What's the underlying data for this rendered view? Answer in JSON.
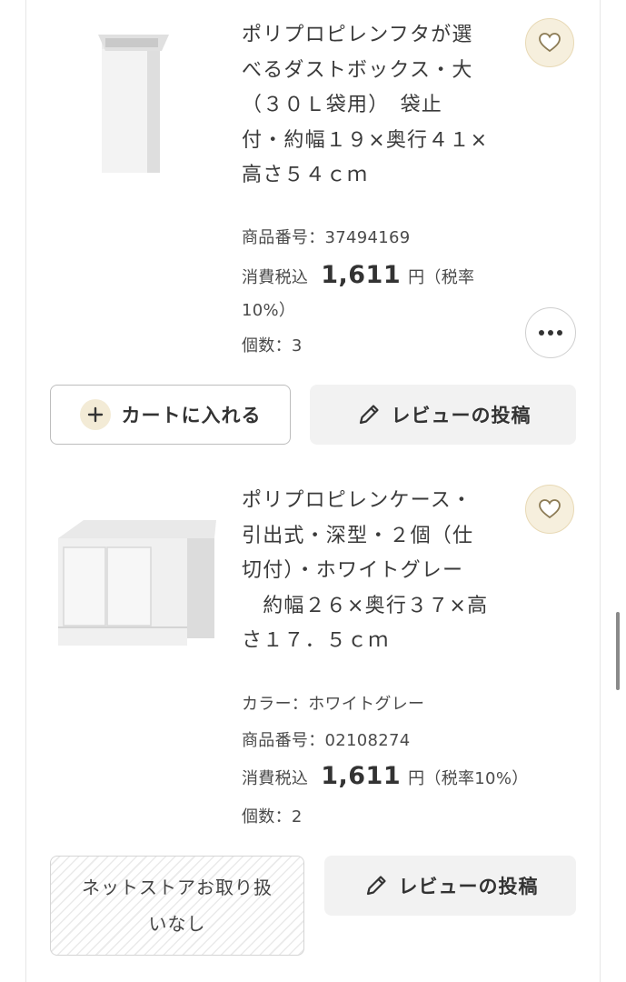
{
  "items": [
    {
      "title_lines": [
        "ポリプロピレンフタが選",
        "べるダストボックス・大",
        "（３０Ｌ袋用）　袋止",
        "付・約幅１９×奥行４１×",
        "高さ５４ｃｍ"
      ],
      "product_number": "商品番号：37494169",
      "price_label": "消費税込",
      "price": "1,611",
      "price_unit_line1": "円（税率",
      "price_unit_line2": "10%）",
      "quantity": "個数：3",
      "cart_button": "カートに入れる",
      "review_button": "レビューの投稿"
    },
    {
      "title_lines": [
        "ポリプロピレンケース・",
        "引出式・深型・２個（仕",
        "切付）・ホワイトグレー",
        "　約幅２６×奥行３７×高",
        "さ１７．５ｃｍ"
      ],
      "color": "カラー：ホワイトグレー",
      "product_number": "商品番号：02108274",
      "price_label": "消費税込",
      "price": "1,611",
      "price_unit": "円（税率10%）",
      "quantity": "個数：2",
      "unavailable_line1": "ネットストアお取り扱",
      "unavailable_line2": "いなし",
      "review_button": "レビューの投稿"
    }
  ],
  "colors": {
    "favorite_bg": "#f6efdd",
    "review_bg": "#f2f2f2",
    "text": "#3c3c3c"
  },
  "icons": [
    "heart-icon",
    "more-dots-icon",
    "plus-icon",
    "pencil-icon"
  ]
}
